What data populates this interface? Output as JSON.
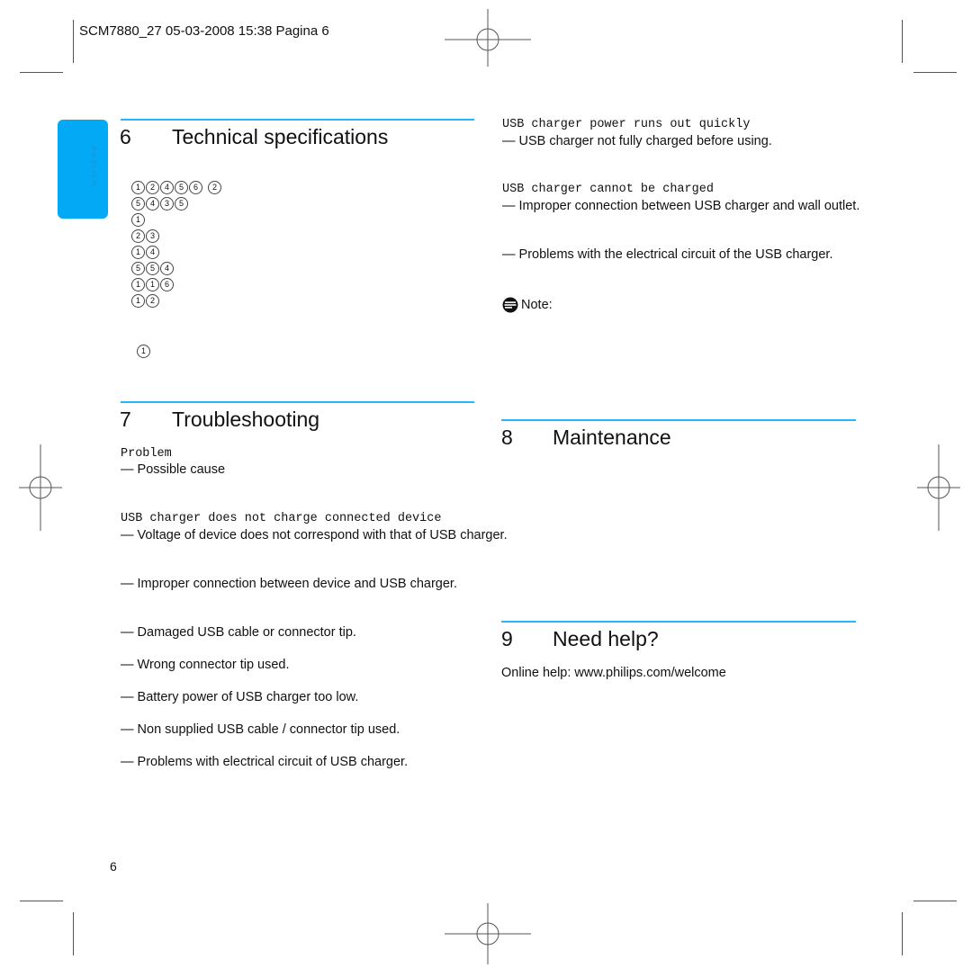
{
  "slug_line": "SCM7880_27  05-03-2008  15:38  Pagina 6",
  "side_tab": {
    "label": "ENGLISH",
    "color": "#03a9f4"
  },
  "accent_color": "#29b6f6",
  "sections": {
    "tech_specs": {
      "number": "6",
      "title": "Technical specifications",
      "circled_rows": [
        [
          "1",
          "2",
          "4",
          "5",
          "6",
          "2"
        ],
        [
          "5",
          "4",
          "3",
          "5"
        ],
        [
          "1"
        ],
        [
          "2",
          "3"
        ],
        [
          "1",
          "4"
        ],
        [
          "5",
          "5",
          "4"
        ],
        [
          "1",
          "1",
          "6"
        ],
        [
          "1",
          "2"
        ]
      ],
      "footnote_marker": "1"
    },
    "troubleshooting": {
      "number": "7",
      "title": "Troubleshooting",
      "legend_problem": "Problem",
      "legend_cause": "— Possible cause",
      "problem_1": {
        "title": "USB charger does not charge connected device",
        "causes": [
          "— Voltage of device does not correspond with that of USB charger.",
          "— Improper connection between device and USB charger.",
          "— Damaged USB cable or connector tip.",
          "— Wrong connector tip used.",
          "— Battery power of USB charger too low.",
          "— Non supplied USB cable / connector tip used.",
          "— Problems with electrical circuit of USB charger."
        ]
      },
      "problem_2": {
        "title": "USB charger power runs out quickly",
        "causes": [
          "— USB charger not fully charged before using."
        ]
      },
      "problem_3": {
        "title": "USB charger cannot be charged",
        "causes": [
          "— Improper connection between USB charger and wall outlet.",
          "— Problems with the electrical circuit of the USB charger."
        ]
      },
      "note_label": "Note:",
      "note_icon": "note-icon"
    },
    "maintenance": {
      "number": "8",
      "title": "Maintenance"
    },
    "need_help": {
      "number": "9",
      "title": "Need help?",
      "online_help": "Online help: www.philips.com/welcome"
    }
  },
  "page_number": "6"
}
